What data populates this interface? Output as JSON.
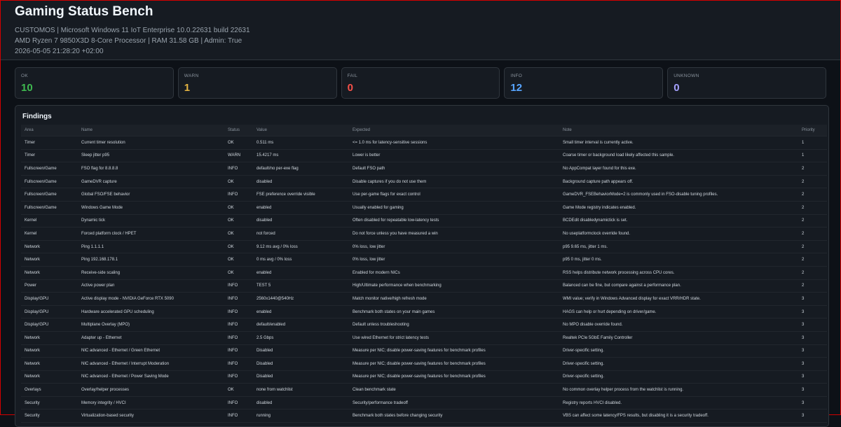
{
  "header": {
    "title": "Gaming Status Bench",
    "line1": "CUSTOMOS | Microsoft Windows 11 IoT Enterprise 10.0.22631 build 22631",
    "line2": "AMD Ryzen 7 9850X3D 8-Core Processor | RAM 31.58 GB | Admin: True",
    "line3": "2026-05-05 21:28:20 +02:00"
  },
  "summary": [
    {
      "label": "OK",
      "value": "10",
      "color": "#3fb950"
    },
    {
      "label": "WARN",
      "value": "1",
      "color": "#e3b341"
    },
    {
      "label": "FAIL",
      "value": "0",
      "color": "#f85149"
    },
    {
      "label": "INFO",
      "value": "12",
      "color": "#58a6ff"
    },
    {
      "label": "UNKNOWN",
      "value": "0",
      "color": "#a5a1ff"
    }
  ],
  "findings": {
    "title": "Findings",
    "columns": [
      "Area",
      "Name",
      "Status",
      "Value",
      "Expected",
      "Note",
      "Priority"
    ],
    "rows": [
      [
        "Timer",
        "Current timer resolution",
        "OK",
        "0.511 ms",
        "<= 1.0 ms for latency-sensitive sessions",
        "Small timer interval is currently active.",
        "1"
      ],
      [
        "Timer",
        "Sleep jitter p95",
        "WARN",
        "15.4217 ms",
        "Lower is better",
        "Coarse timer or background load likely affected this sample.",
        "1"
      ],
      [
        "Fullscreen/Game",
        "FSO flag for 8.8.8.8",
        "INFO",
        "default/no per-exe flag",
        "Default FSO path",
        "No AppCompat layer found for this exe.",
        "2"
      ],
      [
        "Fullscreen/Game",
        "GameDVR capture",
        "OK",
        "disabled",
        "Disable captures if you do not use them",
        "Background capture path appears off.",
        "2"
      ],
      [
        "Fullscreen/Game",
        "Global FSO/FSE behavior",
        "INFO",
        "FSE preference override visible",
        "Use per-game flags for exact control",
        "GameDVR_FSEBehaviorMode=2 is commonly used in FSO-disable tuning profiles.",
        "2"
      ],
      [
        "Fullscreen/Game",
        "Windows Game Mode",
        "OK",
        "enabled",
        "Usually enabled for gaming",
        "Game Mode registry indicates enabled.",
        "2"
      ],
      [
        "Kernel",
        "Dynamic tick",
        "OK",
        "disabled",
        "Often disabled for repeatable low-latency tests",
        "BCDEdit disabledynamictick is set.",
        "2"
      ],
      [
        "Kernel",
        "Forced platform clock / HPET",
        "OK",
        "not forced",
        "Do not force unless you have measured a win",
        "No useplatformclock override found.",
        "2"
      ],
      [
        "Network",
        "Ping 1.1.1.1",
        "OK",
        "9.12 ms avg / 0% loss",
        "0% loss, low jitter",
        "p95 9.65 ms, jitter 1 ms.",
        "2"
      ],
      [
        "Network",
        "Ping 192.168.178.1",
        "OK",
        "0 ms avg / 0% loss",
        "0% loss, low jitter",
        "p95 0 ms, jitter 0 ms.",
        "2"
      ],
      [
        "Network",
        "Receive-side scaling",
        "OK",
        "enabled",
        "Enabled for modern NICs",
        "RSS helps distribute network processing across CPU cores.",
        "2"
      ],
      [
        "Power",
        "Active power plan",
        "INFO",
        "TEST 5",
        "High/Ultimate performance when benchmarking",
        "Balanced can be fine, but compare against a performance plan.",
        "2"
      ],
      [
        "Display/GPU",
        "Active display mode - NVIDIA GeForce RTX 5090",
        "INFO",
        "2560x1440@540Hz",
        "Match monitor native/high refresh mode",
        "WMI value; verify in Windows Advanced display for exact VRR/HDR state.",
        "3"
      ],
      [
        "Display/GPU",
        "Hardware accelerated GPU scheduling",
        "INFO",
        "enabled",
        "Benchmark both states on your main games",
        "HAGS can help or hurt depending on driver/game.",
        "3"
      ],
      [
        "Display/GPU",
        "Multiplane Overlay (MPO)",
        "INFO",
        "default/enabled",
        "Default unless troubleshooting",
        "No MPO disable override found.",
        "3"
      ],
      [
        "Network",
        "Adapter up - Ethernet",
        "INFO",
        "2.5 Gbps",
        "Use wired Ethernet for strict latency tests",
        "Realtek PCIe 5GbE Family Controller",
        "3"
      ],
      [
        "Network",
        "NIC advanced - Ethernet / Green Ethernet",
        "INFO",
        "Disabled",
        "Measure per NIC; disable power-saving features for benchmark profiles",
        "Driver-specific setting.",
        "3"
      ],
      [
        "Network",
        "NIC advanced - Ethernet / Interrupt Moderation",
        "INFO",
        "Disabled",
        "Measure per NIC; disable power-saving features for benchmark profiles",
        "Driver-specific setting.",
        "3"
      ],
      [
        "Network",
        "NIC advanced - Ethernet / Power Saving Mode",
        "INFO",
        "Disabled",
        "Measure per NIC; disable power-saving features for benchmark profiles",
        "Driver-specific setting.",
        "3"
      ],
      [
        "Overlays",
        "Overlay/helper processes",
        "OK",
        "none from watchlist",
        "Clean benchmark state",
        "No common overlay helper process from the watchlist is running.",
        "3"
      ],
      [
        "Security",
        "Memory integrity / HVCI",
        "INFO",
        "disabled",
        "Security/performance tradeoff",
        "Registry reports HVCI disabled.",
        "3"
      ],
      [
        "Security",
        "Virtualization-based security",
        "INFO",
        "running",
        "Benchmark both states before changing security",
        "VBS can affect some latency/FPS results, but disabling it is a security tradeoff.",
        "3"
      ]
    ]
  }
}
